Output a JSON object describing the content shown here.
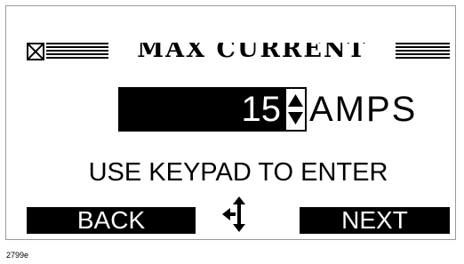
{
  "screen": {
    "title": "MAX CURRENT",
    "value": "15",
    "unit": "AMPS",
    "instruction": "USE KEYPAD TO ENTER"
  },
  "softkeys": {
    "left_label": "BACK",
    "right_label": "NEXT"
  },
  "icons": {
    "close": "close-box-icon",
    "stepper": "up-down-arrows-icon",
    "navigation": "navigation-arrows-icon"
  },
  "figure_id": "2799e",
  "colors": {
    "lcd_foreground": "#000000",
    "lcd_background": "#ffffff"
  }
}
